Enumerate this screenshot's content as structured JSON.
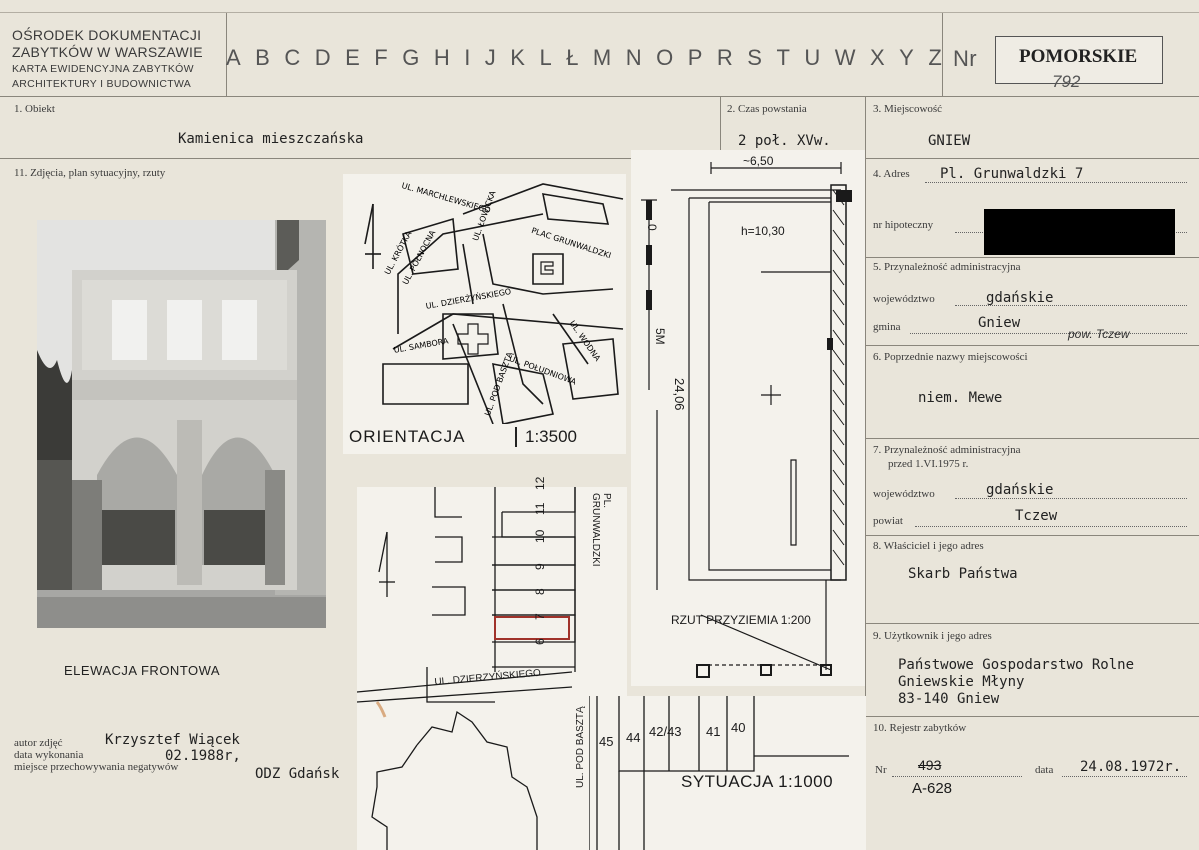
{
  "header": {
    "institution_lines": [
      "OŚRODEK DOKUMENTACJI",
      "ZABYTKÓW W WARSZAWIE",
      "KARTA EWIDENCYJNA ZABYTKÓW",
      "ARCHITEKTURY I BUDOWNICTWA"
    ],
    "letters": [
      "A",
      "B",
      "C",
      "D",
      "E",
      "F",
      "G",
      "H",
      "I",
      "J",
      "K",
      "L",
      "Ł",
      "M",
      "N",
      "O",
      "P",
      "R",
      "S",
      "T",
      "U",
      "W",
      "X",
      "Y",
      "Z"
    ],
    "nr_label": "Nr",
    "region": "POMORSKIE",
    "card_number": "792"
  },
  "fields": {
    "obiekt": {
      "label": "1. Obiekt",
      "value": "Kamienica mieszczańska"
    },
    "czas": {
      "label": "2. Czas powstania",
      "value": "2 poł. XVw."
    },
    "miejscowosc": {
      "label": "3. Miejscowość",
      "value": "GNIEW"
    },
    "zdjecia_label": "11. Zdjęcia, plan sytuacyjny, rzuty",
    "adres": {
      "label": "4. Adres",
      "value": "Pl. Grunwaldzki 7"
    },
    "hipoteczny": {
      "label": "nr hipoteczny"
    },
    "admin": {
      "label": "5. Przynależność administracyjna",
      "woj_label": "województwo",
      "woj_value": "gdańskie",
      "gmina_label": "gmina",
      "gmina_value": "Gniew",
      "note": "pow. Tczew"
    },
    "poprzednie": {
      "label": "6. Poprzednie nazwy miejscowości",
      "value": "niem. Mewe"
    },
    "admin_przed": {
      "label1": "7. Przynależność administracyjna",
      "label2": "przed 1.VI.1975 r.",
      "woj_label": "województwo",
      "woj_value": "gdańskie",
      "powiat_label": "powiat",
      "powiat_value": "Tczew"
    },
    "wlasciciel": {
      "label": "8. Właściciel i jego adres",
      "value": "Skarb Państwa"
    },
    "uzytkownik": {
      "label": "9. Użytkownik i jego adres",
      "lines": [
        "Państwowe Gospodarstwo Rolne",
        "Gniewskie Młyny",
        "83-140 Gniew"
      ]
    },
    "rejestr": {
      "label": "10. Rejestr zabytków",
      "nr_label": "Nr",
      "nr_old": "493",
      "nr_new": "A-628",
      "data_label": "data",
      "data_value": "24.08.1972r."
    }
  },
  "photo": {
    "caption": "ELEWACJA FRONTOWA",
    "autor_label": "autor zdjęć",
    "autor_value": "Krzysztef Wiącek",
    "data_label": "data wykonania",
    "data_value": "02.1988r,",
    "miejsce_label": "miejsce przechowywania negatywów",
    "miejsce_value": "ODZ Gdańsk"
  },
  "orientacja": {
    "label": "ORIENTACJA",
    "scale": "1:3500",
    "streets": [
      "UL. MARCHLEWSKIEGO",
      "PLAC GRUNWALDZKI",
      "UL. DZIERŻYŃSKIEGO",
      "UL. ŁOWICKA",
      "UL. PÓŁNOCNA",
      "UL. KRÓTKA",
      "UL. SAMBORA",
      "UL. POD BASZTĄ",
      "UL. POŁUDNIOWA",
      "UL. WODNA"
    ]
  },
  "rzut": {
    "label": "RZUT PRZYZIEMIA 1:200",
    "width": "~6,50",
    "length": "24,06",
    "height": "h=10,30",
    "scale_zero": "0",
    "scale_five": "5M"
  },
  "sytuacja": {
    "label": "SYTUACJA 1:1000",
    "street_top": "PL. GRUNWALDZKI",
    "street_bottom": "UL. DZIERZYŃSKIEGO",
    "street_side": "UL. POD BASZTĄ",
    "lots_right": [
      "12",
      "11",
      "10",
      "9",
      "8",
      "7",
      "6"
    ],
    "lots_bottom": [
      "45",
      "44",
      "42/43",
      "41",
      "40"
    ]
  }
}
